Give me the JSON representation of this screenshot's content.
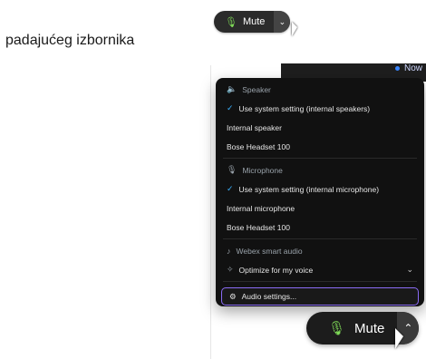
{
  "intro_text": "padajućeg izbornika",
  "mini_button": {
    "label": "Mute"
  },
  "topbar": {
    "label": "Now"
  },
  "menu": {
    "speaker": {
      "header": "Speaker",
      "items": [
        {
          "label": "Use system setting (internal speakers)",
          "checked": true
        },
        {
          "label": "Internal speaker"
        },
        {
          "label": "Bose Headset 100"
        }
      ]
    },
    "microphone": {
      "header": "Microphone",
      "items": [
        {
          "label": "Use system setting (internal microphone)",
          "checked": true
        },
        {
          "label": "Internal microphone"
        },
        {
          "label": "Bose Headset 100"
        }
      ]
    },
    "smart_audio": {
      "header": "Webex smart audio",
      "option": "Optimize for my voice"
    },
    "audio_settings": "Audio settings..."
  },
  "big_button": {
    "label": "Mute"
  },
  "colors": {
    "mic_icon": "#7ed957",
    "check": "#3ab2ff",
    "focus_outline": "#8b6cf6"
  },
  "icons": [
    "microphone-icon",
    "speaker-icon",
    "smart-audio-icon",
    "gear-icon",
    "chevron-down-icon",
    "chevron-up-icon",
    "checkmark-icon",
    "cursor-icon"
  ]
}
